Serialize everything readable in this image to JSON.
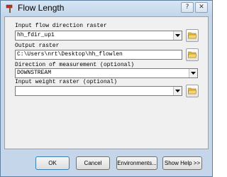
{
  "window": {
    "title": "Flow Length",
    "icons": {
      "app": "hammer-icon",
      "help": "question-mark-icon",
      "close": "close-icon"
    },
    "help_glyph": "?",
    "close_glyph": "✕"
  },
  "form": {
    "flow_direction": {
      "label": "Input flow direction raster",
      "value": "hh_fdir_up1"
    },
    "output": {
      "label": "Output raster",
      "value": "C:\\Users\\nrt\\Desktop\\hh_flowlen"
    },
    "direction": {
      "label": "Direction of measurement (optional)",
      "value": "DOWNSTREAM"
    },
    "weight": {
      "label": "Input weight raster (optional)",
      "value": ""
    }
  },
  "buttons": {
    "ok": "OK",
    "cancel": "Cancel",
    "environments": "Environments...",
    "show_help": "Show Help >>"
  },
  "colors": {
    "title_bar": "#c5d6ea",
    "dialog_background": "#f0f0f0",
    "folder_icon": "#e6b93a"
  }
}
